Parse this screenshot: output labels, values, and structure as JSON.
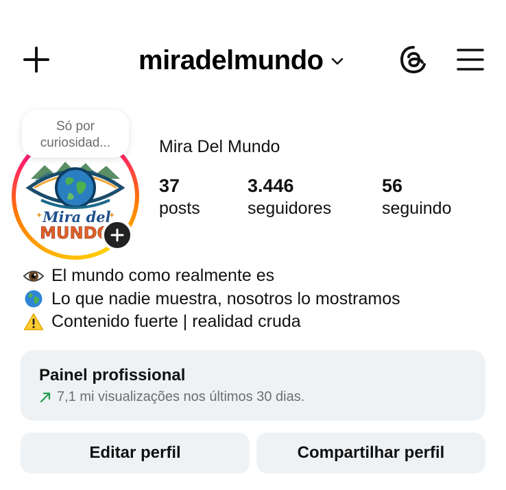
{
  "header": {
    "username": "miradelmundo",
    "icons": {
      "create": "plus-icon",
      "switch_account": "chevron-down-icon",
      "threads": "threads-icon",
      "menu": "hamburger-menu-icon"
    }
  },
  "profile": {
    "note": "Só por curiosidad...",
    "avatar_logo": {
      "line1": "Mira del",
      "line2": "MUNDO"
    },
    "display_name": "Mira Del Mundo",
    "stats": {
      "posts": {
        "value": "37",
        "label": "posts"
      },
      "followers": {
        "value": "3.446",
        "label": "seguidores"
      },
      "following": {
        "value": "56",
        "label": "seguindo"
      }
    }
  },
  "bio": [
    {
      "icon": "eye-emoji",
      "text": "El mundo como realmente es"
    },
    {
      "icon": "globe-emoji",
      "text": "Lo que nadie muestra, nosotros lo mostramos"
    },
    {
      "icon": "warning-emoji",
      "text": "Contenido fuerte | realidad cruda"
    }
  ],
  "dashboard": {
    "title": "Painel profissional",
    "subtitle": "7,1 mi visualizações nos últimos 30 dias.",
    "trend_color": "#1f9c4a"
  },
  "actions": {
    "edit_profile": "Editar perfil",
    "share_profile": "Compartilhar perfil"
  }
}
